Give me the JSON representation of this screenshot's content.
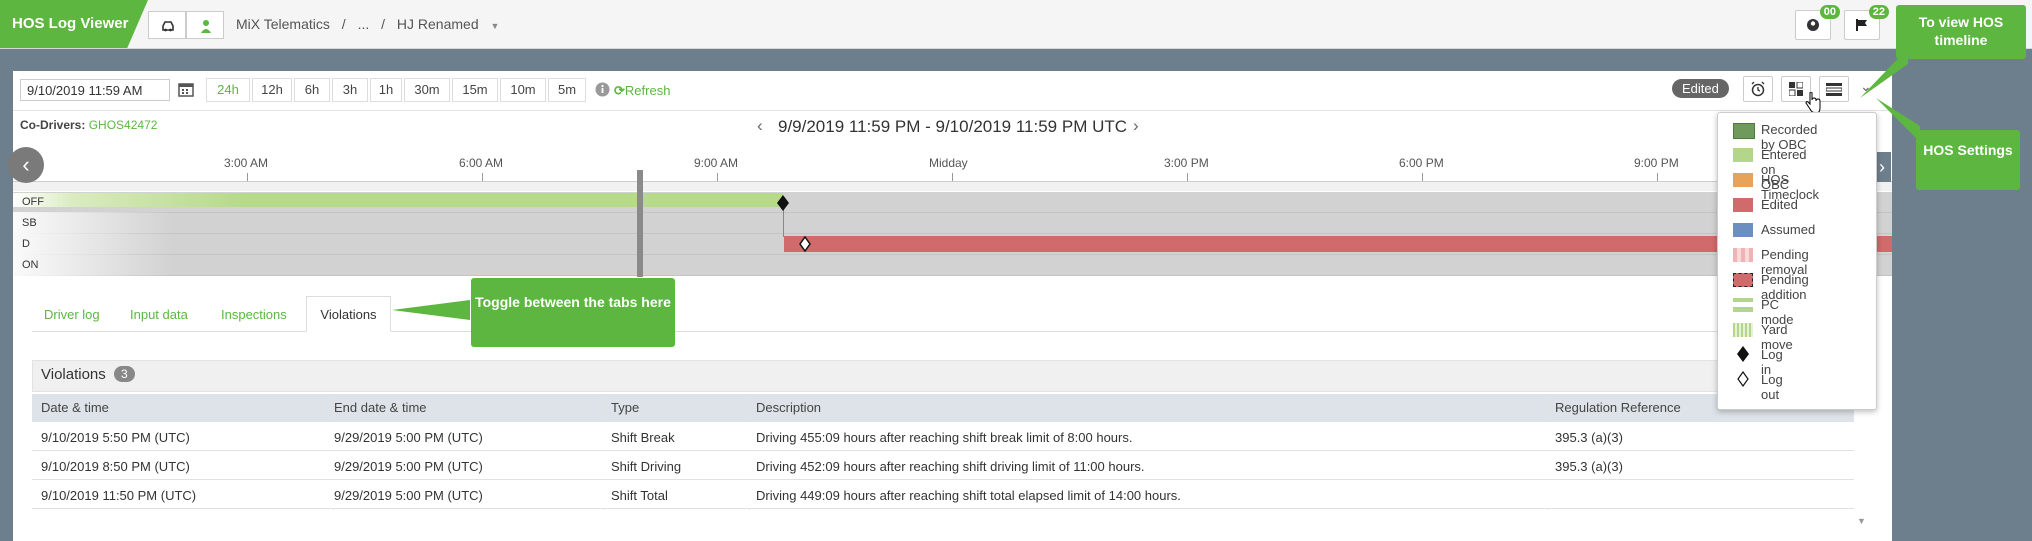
{
  "app": {
    "title": "HOS Log Viewer"
  },
  "breadcrumb": {
    "org": "MiX Telematics",
    "sep1": "/",
    "ellipsis": "...",
    "sep2": "/",
    "current": "HJ Renamed"
  },
  "notifications": {
    "driver_count": "00",
    "flag_count": "22"
  },
  "toolbar": {
    "datetime_value": "9/10/2019 11:59 AM",
    "ranges": [
      "24h",
      "12h",
      "6h",
      "3h",
      "1h",
      "30m",
      "15m",
      "10m",
      "5m"
    ],
    "active_range": "24h",
    "refresh_label": "Refresh",
    "edited_label": "Edited"
  },
  "codrivers": {
    "label": "Co-Drivers:",
    "value": "GHOS42472"
  },
  "range": {
    "title": "9/9/2019 11:59 PM  -  9/10/2019 11:59 PM UTC"
  },
  "timeline": {
    "ticks": [
      "3:00 AM",
      "6:00 AM",
      "9:00 AM",
      "Midday",
      "3:00 PM",
      "6:00 PM",
      "9:00 PM"
    ],
    "rows": [
      "OFF",
      "SB",
      "D",
      "ON"
    ]
  },
  "tabs": [
    "Driver log",
    "Input data",
    "Inspections",
    "Violations"
  ],
  "callouts": {
    "tabs": "Toggle between the tabs here",
    "timeline": "To view HOS timeline",
    "settings": "HOS Settings"
  },
  "violations": {
    "title": "Violations",
    "count": "3",
    "columns": [
      "Date & time",
      "End date & time",
      "Type",
      "Description",
      "Regulation Reference"
    ],
    "rows": [
      [
        "9/10/2019 5:50 PM (UTC)",
        "9/29/2019 5:00 PM (UTC)",
        "Shift Break",
        "Driving 455:09 hours after reaching shift break limit of 8:00 hours.",
        "395.3 (a)(3)"
      ],
      [
        "9/10/2019 8:50 PM (UTC)",
        "9/29/2019 5:00 PM (UTC)",
        "Shift Driving",
        "Driving 452:09 hours after reaching shift driving limit of 11:00 hours.",
        "395.3 (a)(3)"
      ],
      [
        "9/10/2019 11:50 PM (UTC)",
        "9/29/2019 5:00 PM (UTC)",
        "Shift Total",
        "Driving 449:09 hours after reaching shift total elapsed limit of 14:00 hours.",
        ""
      ]
    ]
  },
  "legend": [
    {
      "label": "Recorded by OBC",
      "color": "#6f9a5c"
    },
    {
      "label": "Entered on OBC",
      "color": "#b3d68a"
    },
    {
      "label": "HOS Timeclock",
      "color": "#e8a35a"
    },
    {
      "label": "Edited",
      "color": "#d16a6a"
    },
    {
      "label": "Assumed",
      "color": "#6b8fbf"
    },
    {
      "label": "Pending removal",
      "color": "#efb3b3"
    },
    {
      "label": "Pending addition",
      "color": "#d16a6a"
    },
    {
      "label": "PC mode",
      "color": "#b3d68a"
    },
    {
      "label": "Yard move",
      "color": "#b3d68a"
    },
    {
      "label": "Log in",
      "color": "#222222"
    },
    {
      "label": "Log out",
      "color": "#222222"
    }
  ],
  "colors": {
    "brand_green": "#5cb63f",
    "frame_gray": "#6d7f8c",
    "edited_red": "#d16a6a"
  }
}
